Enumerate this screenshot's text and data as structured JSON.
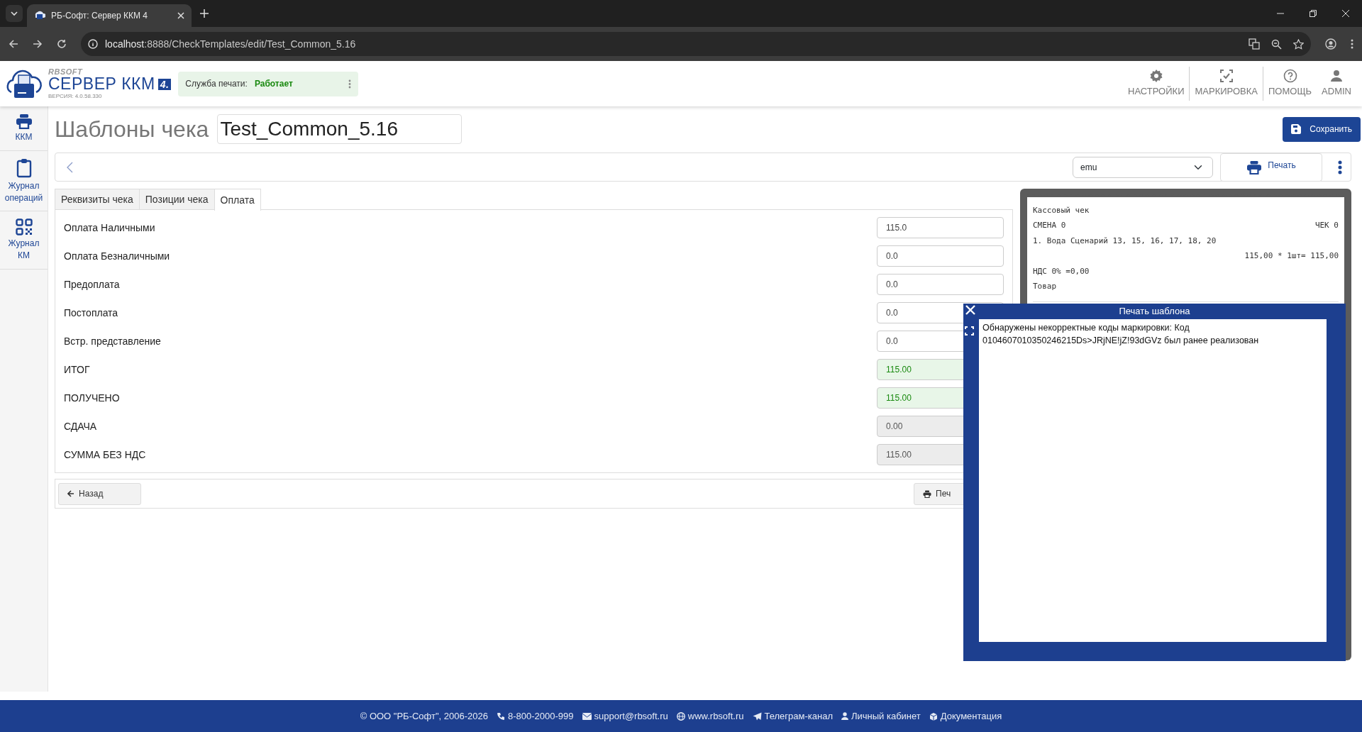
{
  "browser": {
    "tab_title": "РБ-Софт: Сервер ККМ 4",
    "url_host": "localhost",
    "url_rest": ":8888/CheckTemplates/edit/Test_Common_5.16"
  },
  "header": {
    "brand": "RBSOFT",
    "product": "СЕРВЕР ККМ",
    "product_badge": "4.",
    "version": "ВЕРСИЯ: 4.0.58.330",
    "service_label": "Служба печати:",
    "service_status": "Работает",
    "nav": [
      {
        "label": "НАСТРОЙКИ"
      },
      {
        "label": "МАРКИРОВКА"
      },
      {
        "label": "ПОМОЩЬ"
      },
      {
        "label": "ADMIN"
      }
    ]
  },
  "sidebar": [
    {
      "label": "ККМ"
    },
    {
      "label": "Журнал операций"
    },
    {
      "label": "Журнал КМ"
    }
  ],
  "page": {
    "title": "Шаблоны чека",
    "template_name": "Test_Common_5.16",
    "save_button": "Сохранить"
  },
  "toolbar": {
    "device": "emu",
    "print_button": "Печать"
  },
  "tabs": [
    {
      "label": "Реквизиты чека",
      "selected": false
    },
    {
      "label": "Позиции чека",
      "selected": false
    },
    {
      "label": "Оплата",
      "selected": true
    }
  ],
  "fields": [
    {
      "label": "Оплата Наличными",
      "value": "115.0",
      "kind": "input"
    },
    {
      "label": "Оплата Безналичными",
      "value": "0.0",
      "kind": "input"
    },
    {
      "label": "Предоплата",
      "value": "0.0",
      "kind": "input"
    },
    {
      "label": "Постоплата",
      "value": "0.0",
      "kind": "input"
    },
    {
      "label": "Встр. представление",
      "value": "0.0",
      "kind": "input"
    },
    {
      "label": "ИТОГ",
      "value": "115.00",
      "kind": "total"
    },
    {
      "label": "ПОЛУЧЕНО",
      "value": "115.00",
      "kind": "total"
    },
    {
      "label": "СДАЧА",
      "value": "0.00",
      "kind": "readonly"
    },
    {
      "label": "СУММА БЕЗ НДС",
      "value": "115.00",
      "kind": "readonly"
    }
  ],
  "bottom_bar": {
    "back_button": "Назад",
    "print_button": "Печ"
  },
  "receipt": {
    "lines": [
      {
        "left": "Кассовый чек"
      },
      {
        "left": "СМЕНА 0",
        "right": "ЧЕК 0"
      },
      {
        "left": "1. Вода Сценарий 13, 15, 16, 17, 18, 20"
      },
      {
        "right": "115,00 * 1шт= 115,00"
      },
      {
        "left": "НДС 0% =0,00"
      },
      {
        "left": "Товар"
      }
    ]
  },
  "dialog": {
    "title": "Печать шаблона",
    "message": "Обнаружены некорректные коды маркировки: Код 0104607010350246215Ds>JRjNE!jZ!93dGVz был ранее реализован"
  },
  "footer": [
    {
      "text": "© ООО \"РБ-Софт\", 2006-2026"
    },
    {
      "text": "8-800-2000-999"
    },
    {
      "text": "support@rbsoft.ru"
    },
    {
      "text": "www.rbsoft.ru"
    },
    {
      "text": "Телеграм-канал"
    },
    {
      "text": "Личный кабинет"
    },
    {
      "text": "Документация"
    }
  ]
}
